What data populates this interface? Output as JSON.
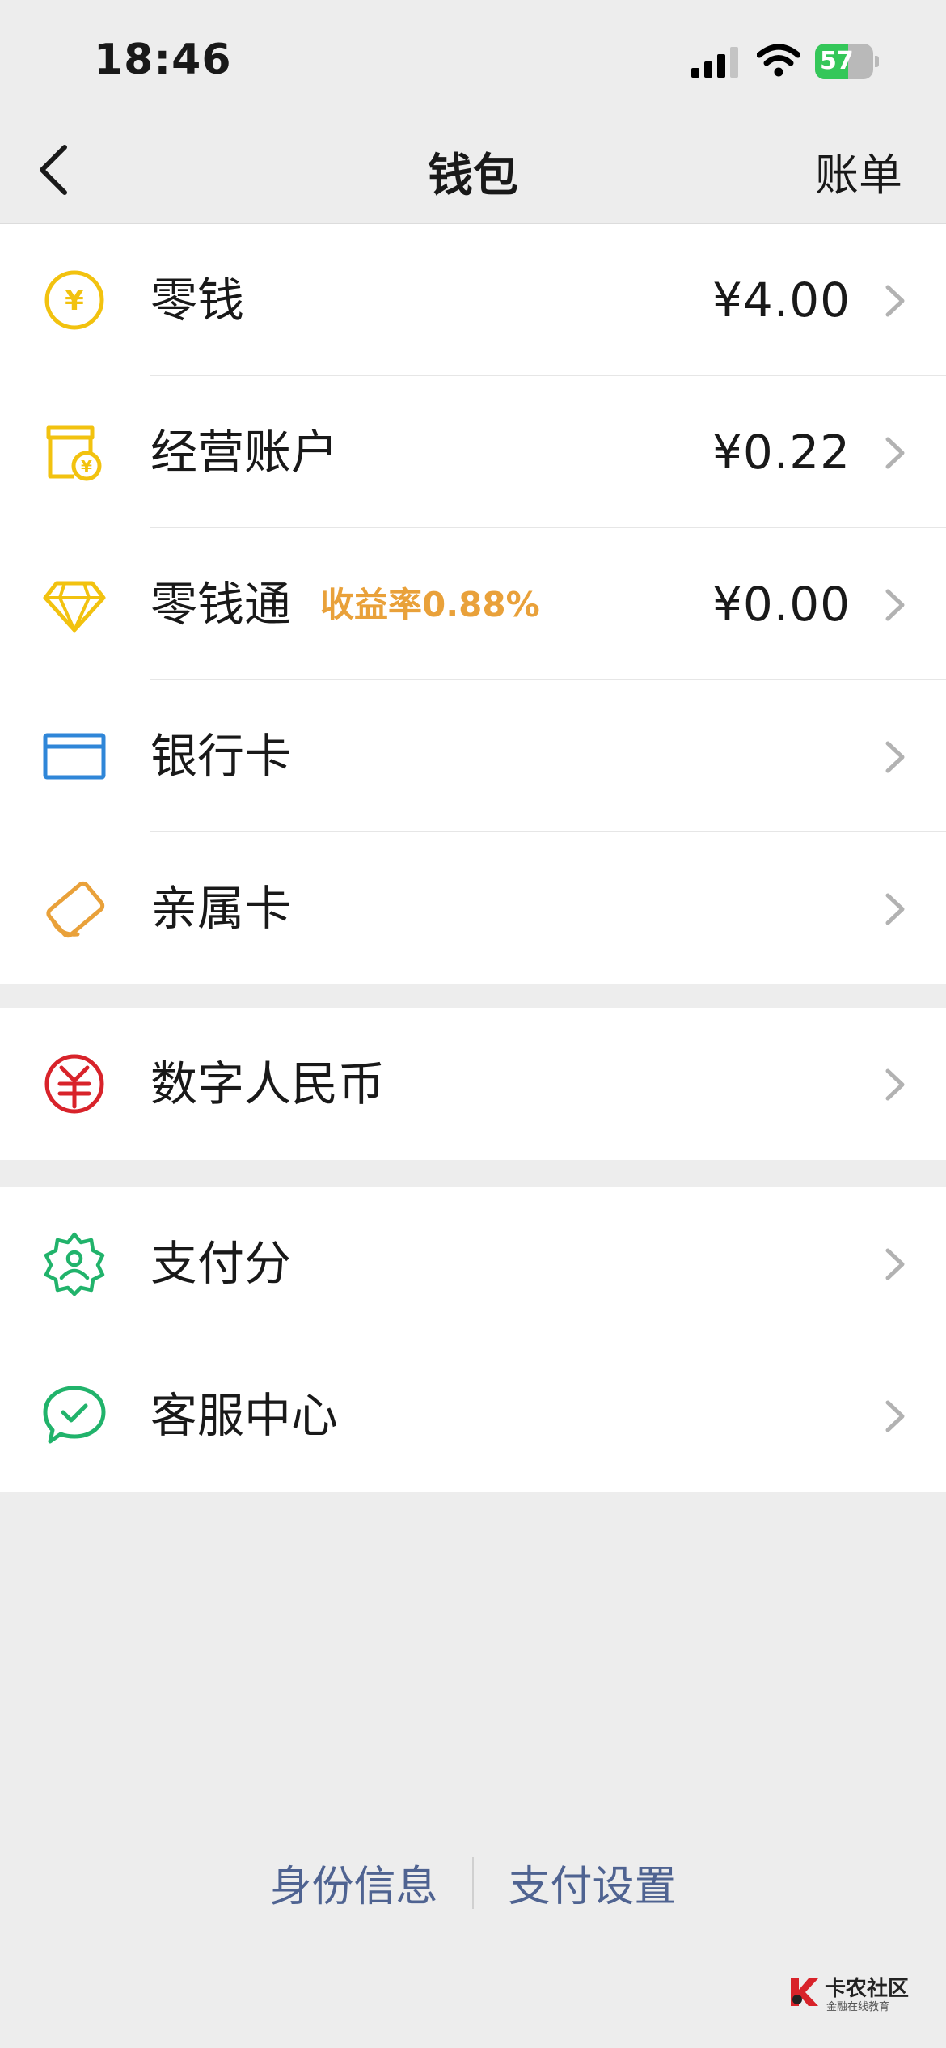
{
  "status_bar": {
    "time": "18:46",
    "battery": "57",
    "battery_level": 0.57
  },
  "nav": {
    "title": "钱包",
    "right_link": "账单"
  },
  "groups": [
    {
      "rows": [
        {
          "label": "零钱",
          "value": "¥4.00",
          "icon": "yuan-coin-icon"
        },
        {
          "label": "经营账户",
          "value": "¥0.22",
          "icon": "shop-account-icon"
        },
        {
          "label": "零钱通",
          "tag": "收益率0.88%",
          "value": "¥0.00",
          "icon": "diamond-icon"
        },
        {
          "label": "银行卡",
          "icon": "bank-card-icon"
        },
        {
          "label": "亲属卡",
          "icon": "family-card-icon"
        }
      ]
    },
    {
      "rows": [
        {
          "label": "数字人民币",
          "icon": "digital-rmb-icon"
        }
      ]
    },
    {
      "rows": [
        {
          "label": "支付分",
          "icon": "pay-score-icon"
        },
        {
          "label": "客服中心",
          "icon": "customer-service-icon"
        }
      ]
    }
  ],
  "footer": {
    "identity": "身份信息",
    "pay_settings": "支付设置"
  },
  "watermark": {
    "title": "卡农社区",
    "subtitle": "金融在线教育"
  },
  "colors": {
    "yellow": "#f2c20f",
    "orange": "#e9a13a",
    "blue": "#2f86d8",
    "red": "#d8232a",
    "green": "#21b36b",
    "link": "#4f6391"
  }
}
